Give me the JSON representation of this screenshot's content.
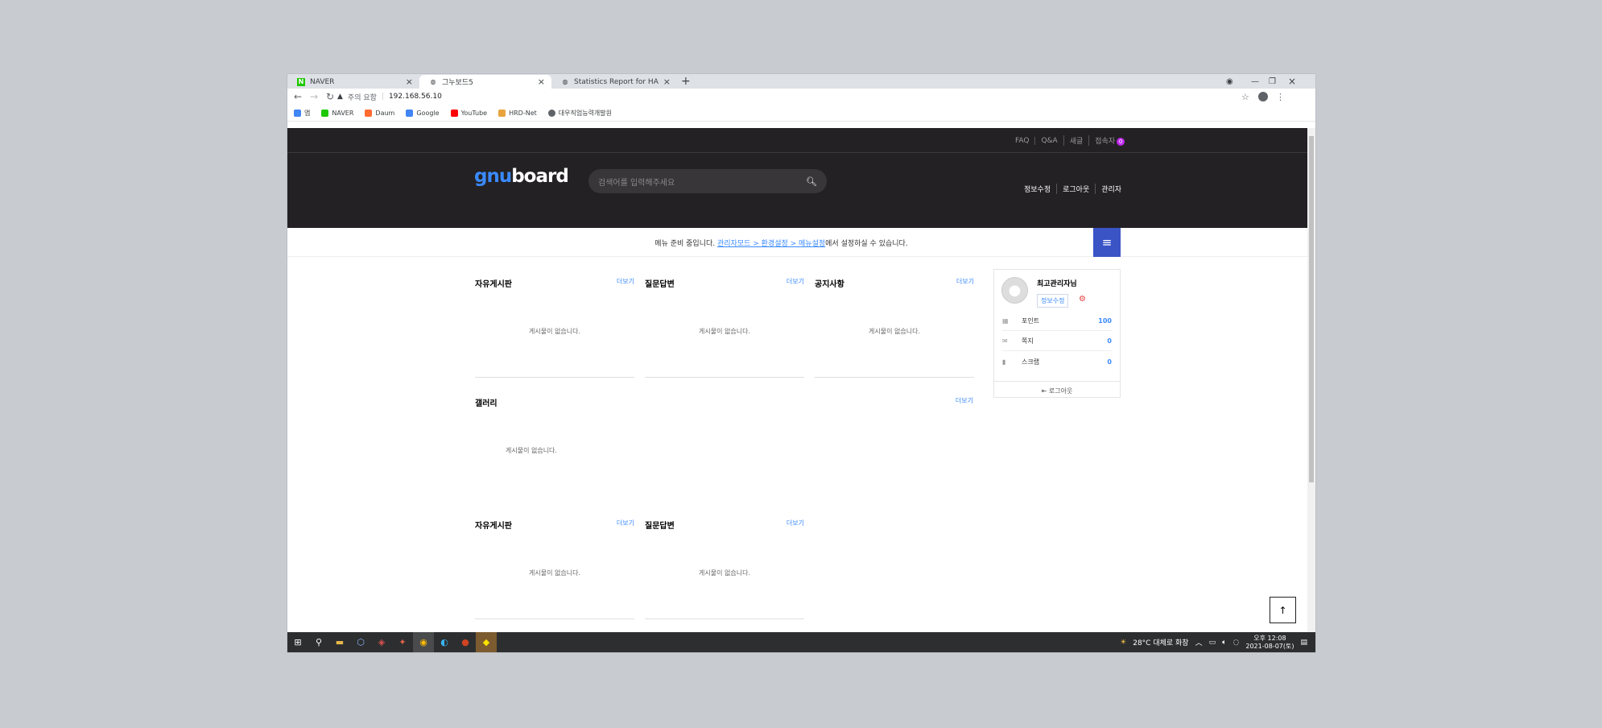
{
  "browser": {
    "tabs": [
      {
        "title": "NAVER",
        "favicon": "N",
        "favicon_color": "#1ec800"
      },
      {
        "title": "그누보드5",
        "favicon": "◍",
        "favicon_color": "#5f6368"
      },
      {
        "title": "Statistics Report for HAProxy",
        "favicon": "◍",
        "favicon_color": "#5f6368"
      }
    ],
    "new_tab": "+",
    "security_label": "주의 요함",
    "url": "192.168.56.10",
    "bookmarks": [
      {
        "label": "앱",
        "color": "#4285f4"
      },
      {
        "label": "NAVER",
        "color": "#1ec800"
      },
      {
        "label": "Daum",
        "color": "#ff6a2f"
      },
      {
        "label": "Google",
        "color": "#4285f4"
      },
      {
        "label": "YouTube",
        "color": "#ff0000"
      },
      {
        "label": "HRD-Net",
        "color": "#e8a33d"
      },
      {
        "label": "대우직업능력개발원",
        "color": "#5f6368"
      }
    ]
  },
  "site": {
    "top_links": [
      "FAQ",
      "Q&A",
      "새글",
      "접속자"
    ],
    "visitor_count": "0",
    "logo_part1": "gnu",
    "logo_part2": "board",
    "search_placeholder": "검색어를 입력해주세요",
    "header_links": [
      "정보수정",
      "로그아웃",
      "관리자"
    ],
    "menu_notice": {
      "prefix": "메뉴 준비 중입니다. ",
      "link": "관리자모드 > 환경설정 > 메뉴설정",
      "suffix": "에서 설정하실 수 있습니다."
    },
    "latest_boards": [
      {
        "title": "자유게시판",
        "more": "더보기",
        "empty": "게시물이 없습니다."
      },
      {
        "title": "질문답변",
        "more": "더보기",
        "empty": "게시물이 없습니다."
      },
      {
        "title": "공지사항",
        "more": "더보기",
        "empty": "게시물이 없습니다."
      }
    ],
    "gallery": {
      "title": "갤러리",
      "more": "더보기",
      "empty": "게시물이 없습니다."
    },
    "latest_boards_2": [
      {
        "title": "자유게시판",
        "more": "더보기",
        "empty": "게시물이 없습니다."
      },
      {
        "title": "질문답변",
        "more": "더보기",
        "empty": "게시물이 없습니다."
      }
    ],
    "outlogin": {
      "name": "최고관리자님",
      "edit_button": "정보수정",
      "rows": [
        {
          "label": "포인트",
          "value": "100",
          "icon": "▦"
        },
        {
          "label": "쪽지",
          "value": "0",
          "icon": "✉"
        },
        {
          "label": "스크랩",
          "value": "0",
          "icon": "▮"
        }
      ],
      "logout": "⇤ 로그아웃"
    }
  },
  "taskbar": {
    "weather": "28°C  대체로 화창",
    "time": "오후 12:08",
    "date": "2021-08-07(토)"
  }
}
